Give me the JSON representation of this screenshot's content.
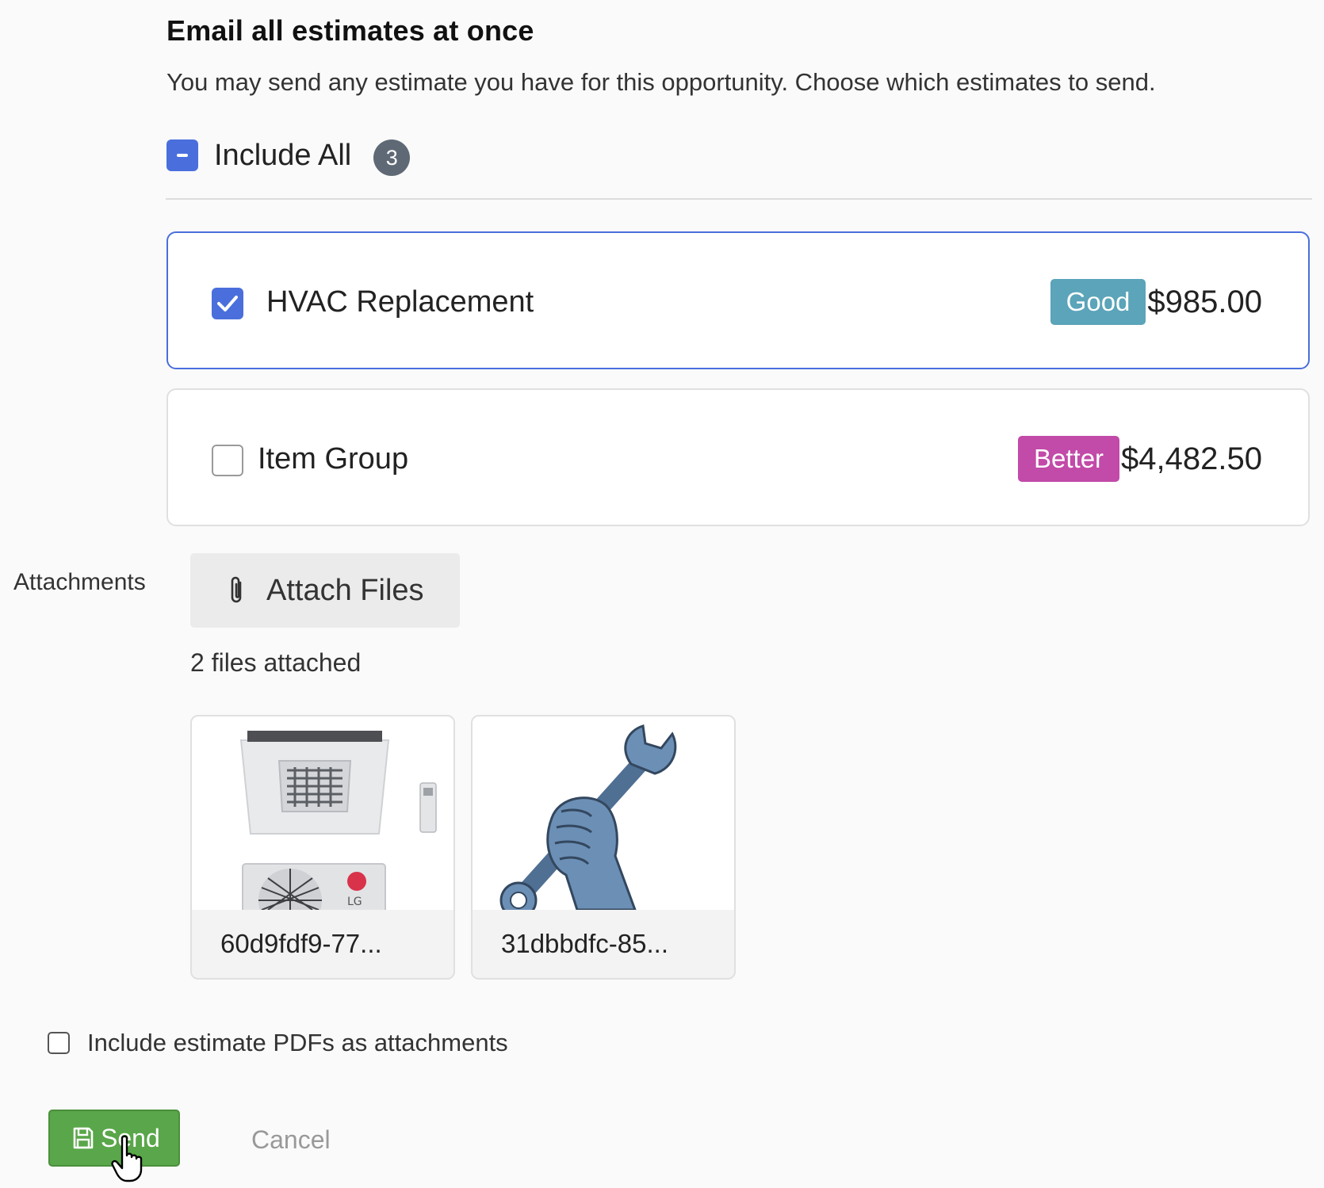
{
  "header": {
    "title": "Email all estimates at once",
    "description": "You may send any estimate you have for this opportunity. Choose which estimates to send."
  },
  "include_all": {
    "label": "Include All",
    "count": "3",
    "state": "indeterminate"
  },
  "estimates": [
    {
      "name": "HVAC Replacement",
      "tier": "Good",
      "tier_color": "#5ba4b9",
      "price": "$985.00",
      "checked": true
    },
    {
      "name": "Item Group",
      "tier": "Better",
      "tier_color": "#c24aa8",
      "price": "$4,482.50",
      "checked": false
    }
  ],
  "attachments": {
    "label": "Attachments",
    "button_label": "Attach Files",
    "files_count": "2 files attached",
    "files": [
      {
        "name": "60d9fdf9-77...",
        "thumbnail": "lg-air-conditioner-units"
      },
      {
        "name": "31dbbdfc-85...",
        "thumbnail": "hand-holding-wrench"
      }
    ]
  },
  "include_pdfs": {
    "label": "Include estimate PDFs as attachments",
    "checked": false
  },
  "actions": {
    "send_label": "Send",
    "cancel_label": "Cancel"
  },
  "colors": {
    "accent": "#4a6fdc",
    "send": "#5aa64a",
    "badge": "#5f6975"
  }
}
